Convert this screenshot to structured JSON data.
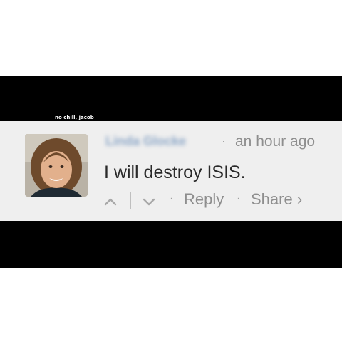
{
  "caption": "no chill, jacob",
  "comment": {
    "author": "Linda Glocke",
    "timestamp": "an hour ago",
    "separator": "·",
    "text": "I will destroy ISIS.",
    "actions": {
      "upvote_icon": "chevron-up-icon",
      "downvote_icon": "chevron-down-icon",
      "reply_label": "Reply",
      "share_label": "Share ›"
    }
  },
  "colors": {
    "band": "#000000",
    "comment_bg": "#efefef",
    "author": "#8aa5c6",
    "meta": "#8e8e8e",
    "text": "#2a2a2a"
  }
}
